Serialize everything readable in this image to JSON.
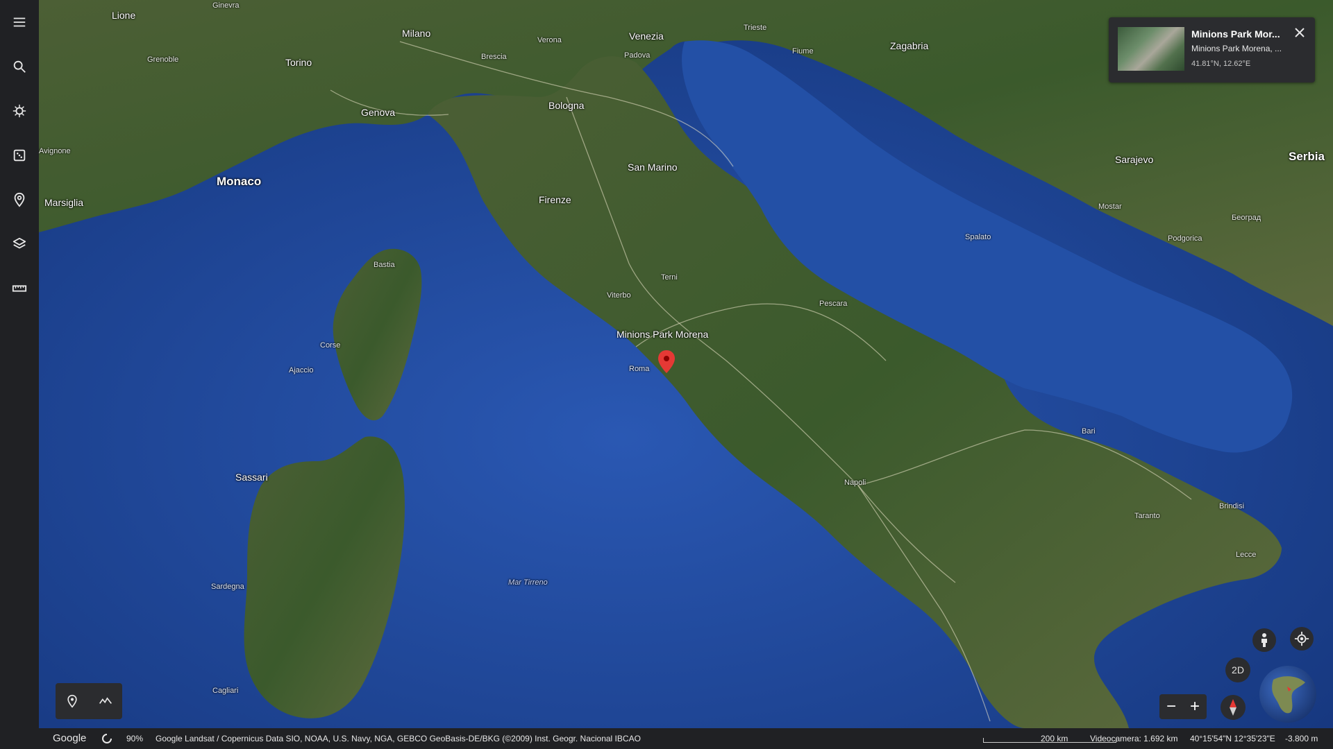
{
  "rail": {
    "items": [
      {
        "name": "menu-icon"
      },
      {
        "name": "search-icon"
      },
      {
        "name": "voyager-icon"
      },
      {
        "name": "feeling-lucky-icon"
      },
      {
        "name": "projects-icon"
      },
      {
        "name": "map-style-icon"
      },
      {
        "name": "measure-icon"
      }
    ]
  },
  "map": {
    "labels": {
      "ginevra": "Ginevra",
      "lione": "Lione",
      "milano": "Milano",
      "venezia": "Venezia",
      "zagabria": "Zagabria",
      "torino": "Torino",
      "grenoble": "Grenoble",
      "verona": "Verona",
      "padova": "Padova",
      "trieste": "Trieste",
      "fiume": "Fiume",
      "brescia": "Brescia",
      "genova": "Genova",
      "bologna": "Bologna",
      "monaco": "Monaco",
      "marsiglia": "Marsiglia",
      "avignone": "Avignone",
      "san_marino": "San Marino",
      "firenze": "Firenze",
      "sarajevo": "Sarajevo",
      "serbia": "Serbia",
      "bastia": "Bastia",
      "corse": "Corse",
      "ajaccio": "Ajaccio",
      "viterbo": "Viterbo",
      "terni": "Terni",
      "pescara": "Pescara",
      "spalato": "Spalato",
      "sassari": "Sassari",
      "sardegna": "Sardegna",
      "cagliari": "Cagliari",
      "mar_tirreno": "Mar Tirreno",
      "bari": "Bari",
      "brindisi": "Brindisi",
      "lecce": "Lecce",
      "taranto": "Taranto",
      "napoli": "Napoli",
      "roma": "Roma",
      "mostar": "Mostar",
      "belgrado": "Београд",
      "podgorica": "Podgorica"
    },
    "pin_label": "Minions Park Morena"
  },
  "card": {
    "title": "Minions Park Mor...",
    "subtitle": "Minions Park Morena, ...",
    "coords": "41.81°N, 12.62°E"
  },
  "status": {
    "logo": "Google",
    "zoom_pct": "90%",
    "attribution": "Google   Landsat / Copernicus   Data SIO, NOAA, U.S. Navy, NGA, GEBCO   GeoBasis-DE/BKG (©2009)   Inst. Geogr. Nacional   IBCAO",
    "scale": "200 km",
    "camera": "Videocamera: 1.692 km",
    "coords": "40°15'54\"N 12°35'23\"E",
    "elevation": "-3.800 m"
  },
  "controls": {
    "mode_2d": "2D"
  },
  "colors": {
    "sea": "#1f4597",
    "land": "#3f5a2e",
    "rail": "#202124",
    "pin": "#e53935"
  }
}
